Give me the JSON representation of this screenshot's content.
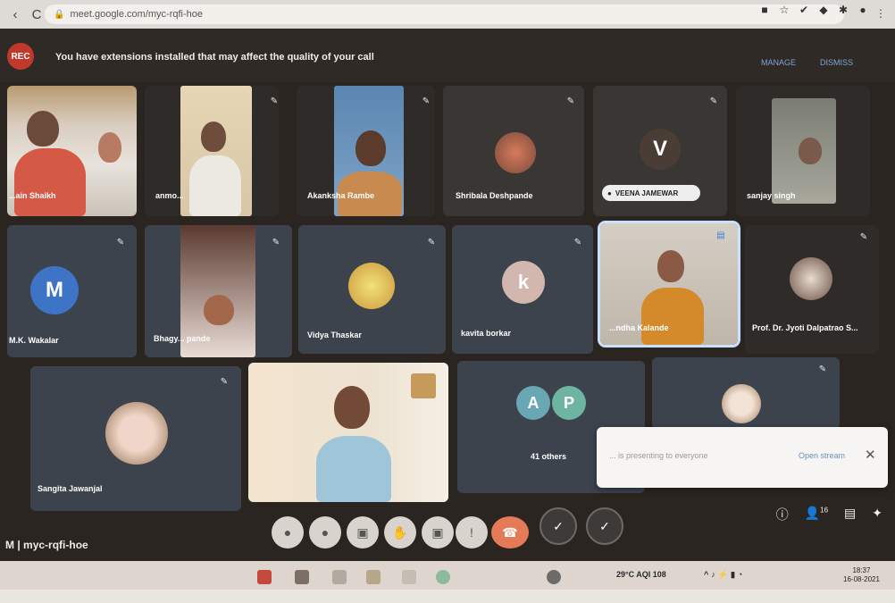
{
  "browser": {
    "back_icon": "arrow-left-icon",
    "reload_icon": "reload-icon",
    "url": "meet.google.com/myc-rqfi-hoe",
    "extension_icons": [
      "video-icon",
      "star-icon",
      "check-icon",
      "extension-icon",
      "puzzle-icon",
      "profile-icon"
    ]
  },
  "banner": {
    "rec_label": "REC",
    "warning": "You have extensions installed that may affect the quality of your call",
    "link_1": "MANAGE",
    "link_2": "DISMISS"
  },
  "participants": [
    {
      "name": "...ain Shaikh"
    },
    {
      "name": "anmo..."
    },
    {
      "name": "Akanksha Rambe"
    },
    {
      "name": "Shribala Deshpande"
    },
    {
      "name": "VEENA JAMEWAR",
      "initial": "V"
    },
    {
      "name": "sanjay singh"
    },
    {
      "name": "M.K. Wakalar",
      "initial": "M"
    },
    {
      "name": "Bhagy... pande"
    },
    {
      "name": "Vidya Thaskar"
    },
    {
      "name": "kavita borkar",
      "initial": "k"
    },
    {
      "name": "...ndha Kalande"
    },
    {
      "name": "Prof. Dr. Jyoti Dalpatrao S..."
    },
    {
      "name": "Sangita Jawanjal"
    },
    {
      "name": ""
    },
    {
      "name": "41 others",
      "initials": [
        "A",
        "P"
      ]
    },
    {
      "name": ""
    }
  ],
  "popup": {
    "text": "... is presenting to everyone",
    "link": "Open stream"
  },
  "meeting_code": "M | myc-rqfi-hoe",
  "controls": {
    "mic": "mic-icon",
    "camera": "camera-icon",
    "captions": "captions-icon",
    "raise_hand": "hand-icon",
    "present": "present-icon",
    "more": "more-icon",
    "leave": "phone-icon"
  },
  "side_icons": {
    "info": "info-icon",
    "people_count": "16",
    "chat": "chat-icon",
    "activities": "activities-icon"
  },
  "taskbar": {
    "weather": "29°C AQI 108",
    "time": "18:37",
    "date": "16-08-2021"
  }
}
